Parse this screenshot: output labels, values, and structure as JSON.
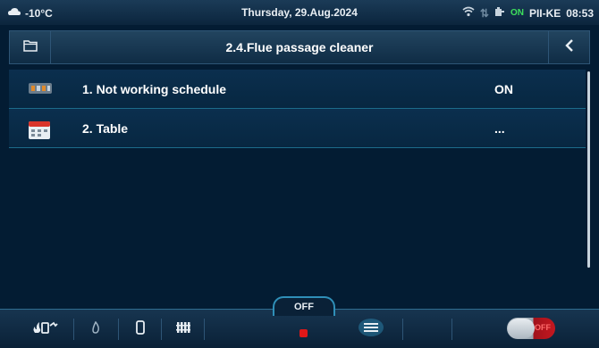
{
  "status_bar": {
    "temperature": "-10°C",
    "date": "Thursday, 29.Aug.2024",
    "on_badge": "ON",
    "device": "PII-KE",
    "time": "08:53"
  },
  "header": {
    "title": "2.4.Flue passage cleaner"
  },
  "list": {
    "items": [
      {
        "label": "1.  Not working schedule",
        "value": "ON"
      },
      {
        "label": "2.  Table",
        "value": "..."
      }
    ]
  },
  "bottom_bar": {
    "mode_label": "OFF",
    "toggle_label": "OFF"
  },
  "colors": {
    "background": "#031c33",
    "accent": "#2f8fb8",
    "on_green": "#3ee05c",
    "off_red": "#e01818"
  }
}
